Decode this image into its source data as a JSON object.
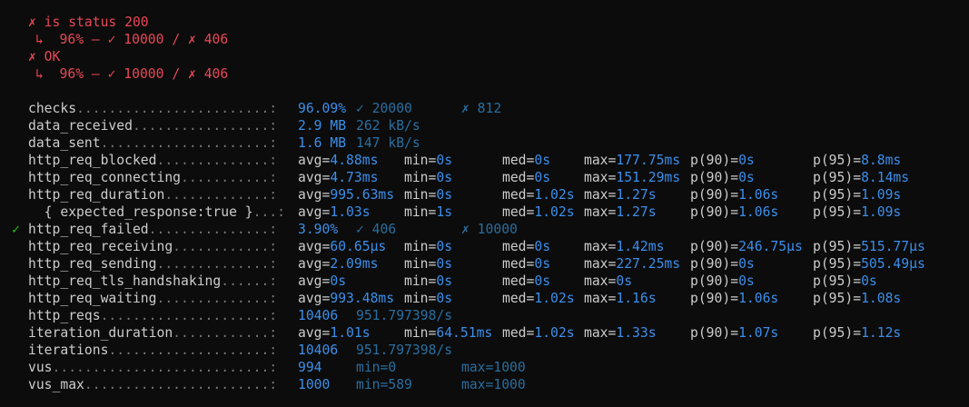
{
  "failures": [
    {
      "title": "✗ is status 200",
      "detail": "↳  96% — ✓ 10000 / ✗ 406"
    },
    {
      "title": "✗ OK",
      "detail": "↳  96% — ✓ 10000 / ✗ 406"
    }
  ],
  "metrics": [
    {
      "name": "checks",
      "dots": "........................:",
      "kind": "rate",
      "pct": "96.09%",
      "a": "✓ 20000",
      "b": "✗ 812"
    },
    {
      "name": "data_received",
      "dots": ".................:",
      "kind": "rate",
      "pct": "2.9 MB",
      "a": "262 kB/s",
      "b": ""
    },
    {
      "name": "data_sent",
      "dots": ".....................:",
      "kind": "rate",
      "pct": "1.6 MB",
      "a": "147 kB/s",
      "b": ""
    },
    {
      "name": "http_req_blocked",
      "dots": "..............:",
      "kind": "trend",
      "avg": "4.88ms",
      "min": "0s",
      "med": "0s",
      "max": "177.75ms",
      "p90": "0s",
      "p95": "8.8ms"
    },
    {
      "name": "http_req_connecting",
      "dots": "...........:",
      "kind": "trend",
      "avg": "4.73ms",
      "min": "0s",
      "med": "0s",
      "max": "151.29ms",
      "p90": "0s",
      "p95": "8.14ms"
    },
    {
      "name": "http_req_duration",
      "dots": ".............:",
      "kind": "trend",
      "avg": "995.63ms",
      "min": "0s",
      "med": "1.02s",
      "max": "1.27s",
      "p90": "1.06s",
      "p95": "1.09s"
    },
    {
      "name": "  { expected_response:true }",
      "dots": "...:",
      "kind": "trend",
      "avg": "1.03s",
      "min": "1s",
      "med": "1.02s",
      "max": "1.27s",
      "p90": "1.06s",
      "p95": "1.09s"
    },
    {
      "name": "http_req_failed",
      "dots": "...............:",
      "kind": "rate",
      "check": "✓",
      "pct": "3.90%",
      "a": "✓ 406",
      "b": "✗ 10000"
    },
    {
      "name": "http_req_receiving",
      "dots": "............:",
      "kind": "trend",
      "avg": "60.65µs",
      "min": "0s",
      "med": "0s",
      "max": "1.42ms",
      "p90": "246.75µs",
      "p95": "515.77µs"
    },
    {
      "name": "http_req_sending",
      "dots": "..............:",
      "kind": "trend",
      "avg": "2.09ms",
      "min": "0s",
      "med": "0s",
      "max": "227.25ms",
      "p90": "0s",
      "p95": "505.49µs"
    },
    {
      "name": "http_req_tls_handshaking",
      "dots": "......:",
      "kind": "trend",
      "avg": "0s",
      "min": "0s",
      "med": "0s",
      "max": "0s",
      "p90": "0s",
      "p95": "0s"
    },
    {
      "name": "http_req_waiting",
      "dots": "..............:",
      "kind": "trend",
      "avg": "993.48ms",
      "min": "0s",
      "med": "1.02s",
      "max": "1.16s",
      "p90": "1.06s",
      "p95": "1.08s"
    },
    {
      "name": "http_reqs",
      "dots": ".....................:",
      "kind": "counter",
      "count": "10406",
      "rate": "951.797398/s"
    },
    {
      "name": "iteration_duration",
      "dots": "............:",
      "kind": "trend",
      "avg": "1.01s",
      "min": "64.51ms",
      "med": "1.02s",
      "max": "1.33s",
      "p90": "1.07s",
      "p95": "1.12s"
    },
    {
      "name": "iterations",
      "dots": "....................:",
      "kind": "counter",
      "count": "10406",
      "rate": "951.797398/s"
    },
    {
      "name": "vus",
      "dots": "...........................:",
      "kind": "gauge",
      "value": "994",
      "min": "min=0",
      "max": "max=1000"
    },
    {
      "name": "vus_max",
      "dots": ".......................:",
      "kind": "gauge",
      "value": "1000",
      "min": "min=589",
      "max": "max=1000"
    }
  ],
  "colors": {
    "background": "#0c0c0c",
    "fail": "#e74856",
    "value": "#3b8eea",
    "dim_value": "#2a6e9e",
    "text": "#cccccc",
    "pass_check": "#16c60c"
  }
}
